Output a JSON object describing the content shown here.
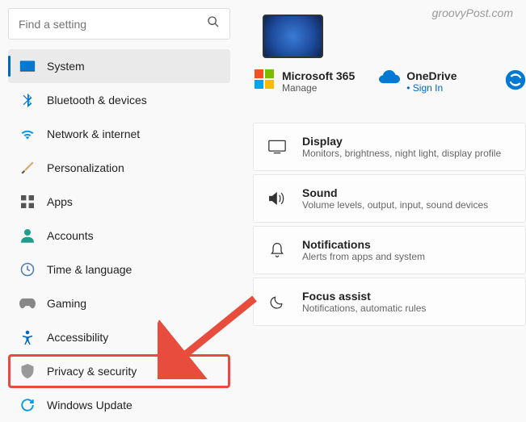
{
  "watermark": "groovyPost.com",
  "search": {
    "placeholder": "Find a setting"
  },
  "sidebar": {
    "items": [
      {
        "label": "System"
      },
      {
        "label": "Bluetooth & devices"
      },
      {
        "label": "Network & internet"
      },
      {
        "label": "Personalization"
      },
      {
        "label": "Apps"
      },
      {
        "label": "Accounts"
      },
      {
        "label": "Time & language"
      },
      {
        "label": "Gaming"
      },
      {
        "label": "Accessibility"
      },
      {
        "label": "Privacy & security"
      },
      {
        "label": "Windows Update"
      }
    ]
  },
  "services": {
    "microsoft365": {
      "title": "Microsoft 365",
      "sub": "Manage"
    },
    "onedrive": {
      "title": "OneDrive",
      "sub": "Sign In"
    }
  },
  "cards": [
    {
      "title": "Display",
      "sub": "Monitors, brightness, night light, display profile"
    },
    {
      "title": "Sound",
      "sub": "Volume levels, output, input, sound devices"
    },
    {
      "title": "Notifications",
      "sub": "Alerts from apps and system"
    },
    {
      "title": "Focus assist",
      "sub": "Notifications, automatic rules"
    }
  ]
}
